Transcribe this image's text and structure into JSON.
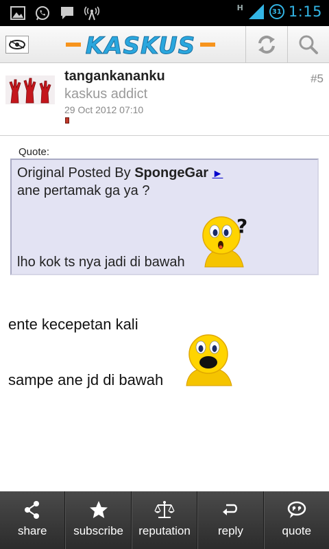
{
  "status_bar": {
    "time": "1:15",
    "network": "H",
    "battery": "31",
    "left_icons": [
      "image-icon",
      "whatsapp-icon",
      "chat-icon",
      "signal-tower-icon"
    ]
  },
  "app_bar": {
    "logo_text": "KASKUS",
    "brand_color": "#2aa7de",
    "accent_color": "#f7941d",
    "actions": [
      "refresh-icon",
      "search-icon"
    ]
  },
  "post": {
    "username": "tangankananku",
    "user_title": "kaskus addict",
    "date": "29 Oct 2012 07:10",
    "post_number": "#5",
    "quote": {
      "label": "Quote:",
      "prefix": "Original Posted By ",
      "author": "SpongeGar",
      "arrow": "►",
      "line1": "ane pertamak ga ya ?",
      "line2": "lho kok ts nya jadi di bawah"
    },
    "body_line1": "ente kecepetan kali",
    "body_line2": "sampe ane jd di bawah"
  },
  "toolbar": {
    "items": [
      {
        "label": "share",
        "icon": "share-icon"
      },
      {
        "label": "subscribe",
        "icon": "star-icon"
      },
      {
        "label": "reputation",
        "icon": "scales-icon"
      },
      {
        "label": "reply",
        "icon": "reply-icon"
      },
      {
        "label": "quote",
        "icon": "quote-bubble-icon"
      }
    ]
  }
}
